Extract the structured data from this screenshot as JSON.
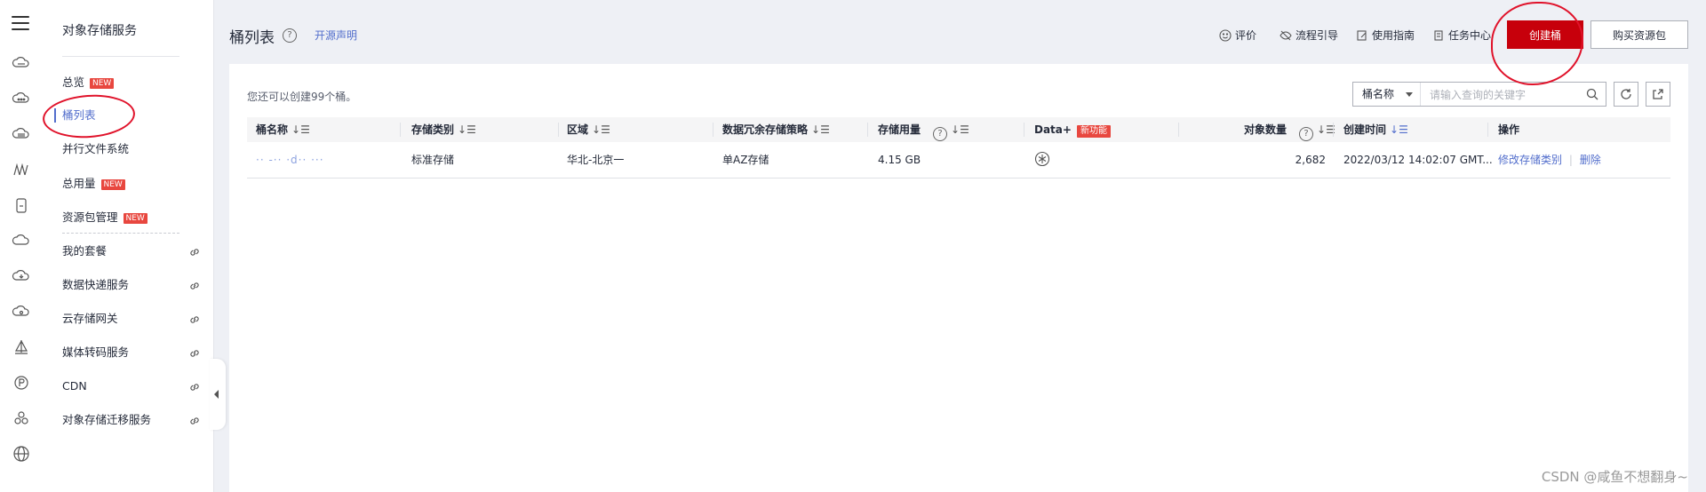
{
  "rail": {
    "icons": [
      "menu-icon",
      "cloud-server-icon",
      "cloud-ellipsis-icon",
      "cloud-storage-icon",
      "rings-icon",
      "bottle-icon",
      "cloud-icon",
      "cloud-download-icon",
      "cloud-gear-icon",
      "sail-icon",
      "globe-p-icon",
      "cluster-icon",
      "globe-icon"
    ]
  },
  "sidebar": {
    "title": "对象存储服务",
    "items": [
      {
        "label": "总览",
        "badge": "NEW",
        "active": false
      },
      {
        "label": "桶列表",
        "badge": "",
        "active": true
      },
      {
        "label": "并行文件系统",
        "badge": "",
        "active": false
      },
      {
        "label": "总用量",
        "badge": "NEW",
        "active": false
      },
      {
        "label": "资源包管理",
        "badge": "NEW",
        "active": false
      }
    ],
    "links": [
      {
        "label": "我的套餐"
      },
      {
        "label": "数据快递服务"
      },
      {
        "label": "云存储网关"
      },
      {
        "label": "媒体转码服务"
      },
      {
        "label": "CDN"
      },
      {
        "label": "对象存储迁移服务"
      }
    ]
  },
  "header": {
    "title": "桶列表",
    "help": "?",
    "oss_link": "开源声明",
    "actions": {
      "rate": "评价",
      "guide": "流程引导",
      "manual": "使用指南",
      "tasks": "任务中心"
    },
    "create_button": "创建桶",
    "buy_button": "购买资源包"
  },
  "card": {
    "info": "您还可以创建99个桶。",
    "search": {
      "select": "桶名称",
      "placeholder": "请输入查询的关键字"
    }
  },
  "table": {
    "columns": [
      "桶名称",
      "存储类别",
      "区域",
      "数据冗余存储策略",
      "存储用量",
      "Data+",
      "对象数量",
      "创建时间",
      "操作"
    ],
    "column_badge": "新功能",
    "sort_glyph": "↓☰",
    "rows": [
      {
        "name": "·· -·· ·d·· ···",
        "storage_class": "标准存储",
        "region": "华北-北京一",
        "redundancy": "单AZ存储",
        "usage": "4.15 GB",
        "objects": "2,682",
        "created": "2022/03/12 14:02:07 GMT...",
        "op_modify": "修改存储类别",
        "op_delete": "删除"
      }
    ]
  },
  "watermark": "CSDN @咸鱼不想翻身~",
  "colors": {
    "primary": "#c7000b",
    "link": "#526ecc",
    "badge": "#e8473f",
    "annotation": "#e0122a"
  }
}
